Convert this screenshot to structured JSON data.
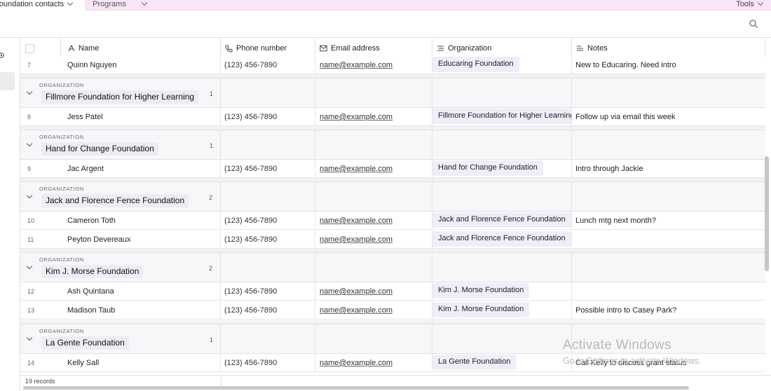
{
  "tabs": {
    "active": "Foundation contacts",
    "programs": "Programs",
    "tools": "Tools"
  },
  "columns": {
    "name": "Name",
    "phone": "Phone number",
    "email": "Email address",
    "organization": "Organization",
    "notes": "Notes"
  },
  "group_label": "ORGANIZATION",
  "rows": {
    "r7": {
      "num": "7",
      "name": "Quinn Nguyen",
      "phone": "(123) 456-7890",
      "email": "name@example.com",
      "org": "Educaring Foundation",
      "notes": "New to Educaring. Need intro"
    },
    "r8": {
      "num": "8",
      "name": "Jess Patel",
      "phone": "(123) 456-7890",
      "email": "name@example.com",
      "org": "Fillmore Foundation for Higher Learning",
      "notes": "Follow up via email this week"
    },
    "r9": {
      "num": "9",
      "name": "Jac Argent",
      "phone": "(123) 456-7890",
      "email": "name@example.com",
      "org": "Hand for Change Foundation",
      "notes": "Intro through Jackie"
    },
    "r10": {
      "num": "10",
      "name": "Cameron Toth",
      "phone": "(123) 456-7890",
      "email": "name@example.com",
      "org": "Jack and Florence Fence Foundation",
      "notes": "Lunch mtg next month?"
    },
    "r11": {
      "num": "11",
      "name": "Peyton Devereaux",
      "phone": "(123) 456-7890",
      "email": "name@example.com",
      "org": "Jack and Florence Fence Foundation",
      "notes": ""
    },
    "r12": {
      "num": "12",
      "name": "Ash Quintana",
      "phone": "(123) 456-7890",
      "email": "name@example.com",
      "org": "Kim J. Morse Foundation",
      "notes": ""
    },
    "r13": {
      "num": "13",
      "name": "Madison Taub",
      "phone": "(123) 456-7890",
      "email": "name@example.com",
      "org": "Kim J. Morse Foundation",
      "notes": "Possible intro to Casey Park?"
    },
    "r14": {
      "num": "14",
      "name": "Kelly Sall",
      "phone": "(123) 456-7890",
      "email": "name@example.com",
      "org": "La Gente Foundation",
      "notes": "Call Kelly to discuss grant status"
    }
  },
  "groups": {
    "g1": {
      "name": "Fillmore Foundation for Higher Learning",
      "count": "1"
    },
    "g2": {
      "name": "Hand for Change Foundation",
      "count": "1"
    },
    "g3": {
      "name": "Jack and Florence Fence Foundation",
      "count": "2"
    },
    "g4": {
      "name": "Kim J. Morse Foundation",
      "count": "2"
    },
    "g5": {
      "name": "La Gente Foundation",
      "count": "1"
    }
  },
  "footer": {
    "records": "19 records"
  },
  "watermark": {
    "title": "Activate Windows",
    "subtitle": "Go to Settings to activate Windows."
  }
}
